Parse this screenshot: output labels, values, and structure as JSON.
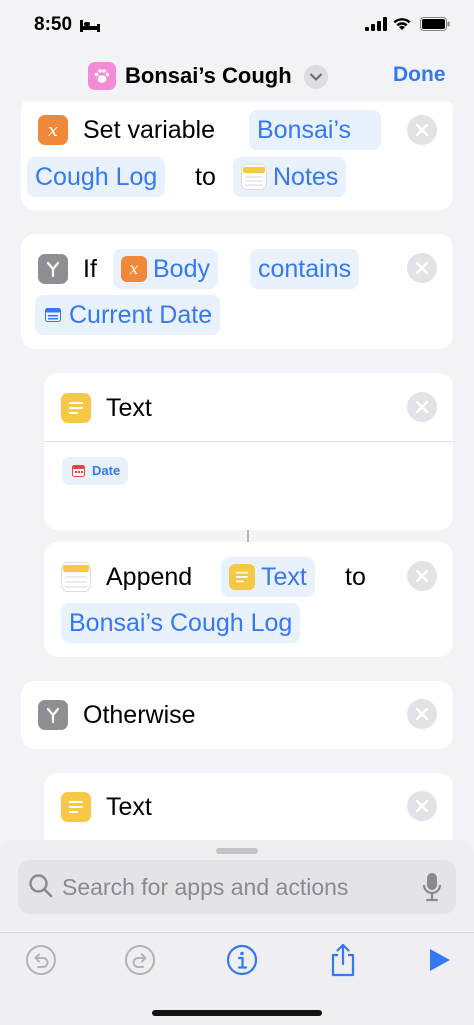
{
  "status_bar": {
    "time": "8:50"
  },
  "nav": {
    "title": "Bonsai’s Cough",
    "done_label": "Done"
  },
  "actions": {
    "set_variable": {
      "label": "Set variable",
      "variable_name_line1": "Bonsai’s",
      "variable_name_line2": "Cough Log",
      "to_label": "to",
      "value": "Notes"
    },
    "if_block": {
      "label": "If",
      "input": "Body",
      "condition": "contains",
      "value": "Current Date"
    },
    "text1": {
      "label": "Text",
      "token": "Date"
    },
    "append": {
      "label": "Append",
      "input": "Text",
      "to_label": "to",
      "target": "Bonsai’s Cough Log"
    },
    "otherwise": {
      "label": "Otherwise"
    },
    "text2": {
      "label": "Text"
    }
  },
  "bottom_sheet": {
    "search_placeholder": "Search for apps and actions"
  },
  "colors": {
    "accent": "#3478f6",
    "variable_orange": "#f0883a",
    "text_yellow": "#f7c846",
    "if_gray": "#8e8e93",
    "app_icon_pink": "#f48bd6"
  },
  "icons": [
    "paw-icon",
    "chevron-down-icon",
    "variable-icon",
    "if-icon",
    "text-icon",
    "notes-icon",
    "calendar-icon",
    "close-icon",
    "search-icon",
    "mic-icon",
    "undo-icon",
    "redo-icon",
    "info-icon",
    "share-icon",
    "play-icon"
  ]
}
